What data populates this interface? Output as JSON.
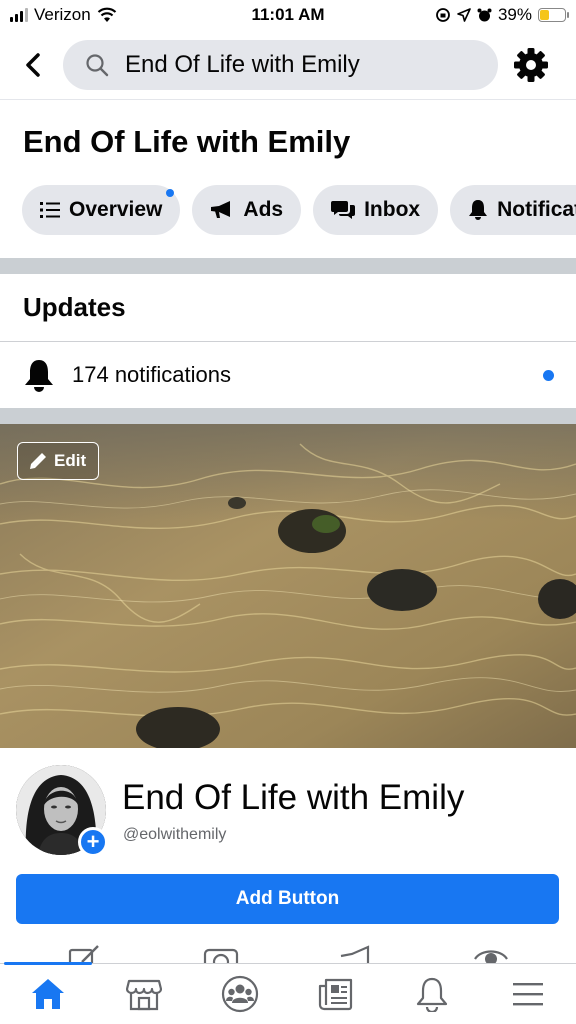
{
  "status_bar": {
    "carrier": "Verizon",
    "time": "11:01 AM",
    "battery_percent": "39%",
    "battery_level": 0.39
  },
  "search": {
    "query": "End Of Life with Emily",
    "back_icon": "chevron-left-icon",
    "search_icon": "search-icon",
    "settings_icon": "gear-icon"
  },
  "page": {
    "title": "End Of Life with Emily"
  },
  "chips": [
    {
      "label": "Overview",
      "icon": "list-icon",
      "has_dot": true
    },
    {
      "label": "Ads",
      "icon": "megaphone-icon",
      "has_dot": false
    },
    {
      "label": "Inbox",
      "icon": "chat-bubbles-icon",
      "has_dot": false
    },
    {
      "label": "Notifications",
      "icon": "bell-icon",
      "has_dot": false
    }
  ],
  "updates": {
    "heading": "Updates",
    "notifications_text": "174 notifications"
  },
  "cover": {
    "edit_label": "Edit"
  },
  "profile": {
    "name": "End Of Life with Emily",
    "handle": "@eolwithemily"
  },
  "actions": {
    "add_button_label": "Add Button"
  },
  "colors": {
    "accent": "#1877f2",
    "chip_bg": "#e4e6eb",
    "divider": "#cacfd3"
  },
  "tabbar": {
    "items": [
      "home-icon",
      "marketplace-icon",
      "groups-icon",
      "news-icon",
      "bell-icon",
      "menu-icon"
    ],
    "active": "home-icon"
  }
}
